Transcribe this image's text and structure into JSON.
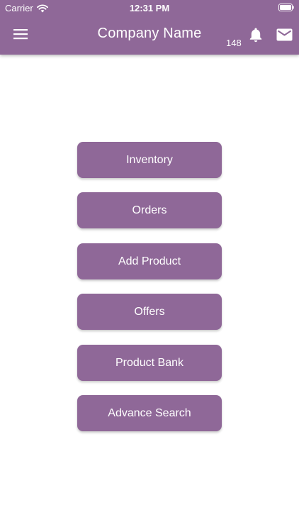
{
  "status_bar": {
    "carrier": "Carrier",
    "time": "12:31 PM",
    "wifi_icon": "wifi-icon",
    "battery_icon": "battery-icon"
  },
  "nav_bar": {
    "title": "Company Name",
    "notification_count": "148",
    "menu_icon": "hamburger-menu-icon",
    "bell_icon": "bell-icon",
    "mail_icon": "mail-icon"
  },
  "menu": {
    "buttons": [
      {
        "label": "Inventory"
      },
      {
        "label": "Orders"
      },
      {
        "label": "Add Product"
      },
      {
        "label": "Offers"
      },
      {
        "label": "Product Bank"
      },
      {
        "label": "Advance Search"
      }
    ]
  },
  "colors": {
    "primary": "#8f6898",
    "text_on_primary": "#ffffff",
    "background": "#ffffff"
  }
}
